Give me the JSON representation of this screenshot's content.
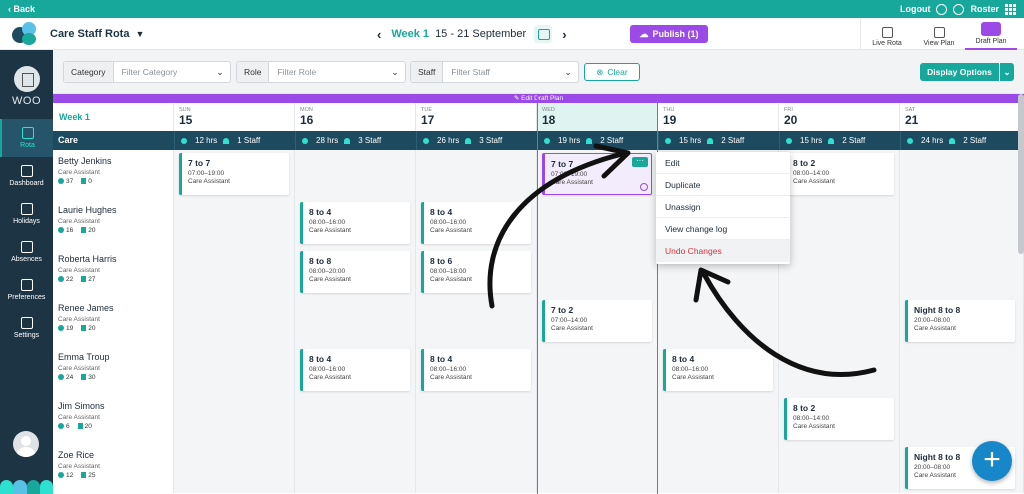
{
  "topbar": {
    "back": "‹ Back",
    "logout": "Logout",
    "roster": "Roster"
  },
  "header": {
    "app_title": "Care Staff Rota",
    "week_label": "Week 1",
    "week_range": "15 - 21 September",
    "publish_label": "Publish (1)"
  },
  "view_tabs": [
    {
      "label": "Live Rota"
    },
    {
      "label": "View Plan"
    },
    {
      "label": "Draft Plan",
      "active": true
    }
  ],
  "sidebar": {
    "org": "WOO",
    "items": [
      {
        "label": "Rota",
        "icon": "calendar-icon",
        "active": true
      },
      {
        "label": "Dashboard",
        "icon": "dashboard-icon"
      },
      {
        "label": "Holidays",
        "icon": "holiday-icon"
      },
      {
        "label": "Absences",
        "icon": "absence-icon"
      },
      {
        "label": "Preferences",
        "icon": "preferences-icon"
      },
      {
        "label": "Settings",
        "icon": "gear-icon"
      }
    ]
  },
  "filters": {
    "category": {
      "label": "Category",
      "placeholder": "Filter Category"
    },
    "role": {
      "label": "Role",
      "placeholder": "Filter Role"
    },
    "staff": {
      "label": "Staff",
      "placeholder": "Filter Staff"
    },
    "clear_label": "Clear",
    "display_options": "Display Options"
  },
  "draft_banner": "✎ Edit Draft Plan",
  "days": [
    {
      "name": "SUN",
      "date": "15",
      "hrs": "12 hrs",
      "staff": "1 Staff"
    },
    {
      "name": "MON",
      "date": "16",
      "hrs": "28 hrs",
      "staff": "3 Staff"
    },
    {
      "name": "TUE",
      "date": "17",
      "hrs": "26 hrs",
      "staff": "3 Staff"
    },
    {
      "name": "WED",
      "date": "18",
      "hrs": "19 hrs",
      "staff": "2 Staff"
    },
    {
      "name": "THU",
      "date": "19",
      "hrs": "15 hrs",
      "staff": "2 Staff"
    },
    {
      "name": "FRI",
      "date": "20",
      "hrs": "15 hrs",
      "staff": "2 Staff"
    },
    {
      "name": "SAT",
      "date": "21",
      "hrs": "24 hrs",
      "staff": "2 Staff"
    }
  ],
  "category": "Care",
  "staff": [
    {
      "name": "Betty Jenkins",
      "role": "Care Assistant",
      "hours": "37",
      "shifts": "0",
      "shifts_by_day": [
        {
          "day": 0,
          "title": "7 to 7",
          "time": "07:00–19:00",
          "role": "Care Assistant"
        },
        {
          "day": 3,
          "title": "7 to 7",
          "time": "07:00–19:00",
          "role": "Care Assistant",
          "selected": true
        },
        {
          "day": 5,
          "title": "8 to 2",
          "time": "08:00–14:00",
          "role": "Care Assistant"
        }
      ]
    },
    {
      "name": "Laurie Hughes",
      "role": "Care Assistant",
      "hours": "16",
      "shifts": "20",
      "shifts_by_day": [
        {
          "day": 1,
          "title": "8 to 4",
          "time": "08:00–16:00",
          "role": "Care Assistant"
        },
        {
          "day": 2,
          "title": "8 to 4",
          "time": "08:00–16:00",
          "role": "Care Assistant"
        }
      ]
    },
    {
      "name": "Roberta Harris",
      "role": "Care Assistant",
      "hours": "22",
      "shifts": "27",
      "shifts_by_day": [
        {
          "day": 1,
          "title": "8 to 8",
          "time": "08:00–20:00",
          "role": "Care Assistant"
        },
        {
          "day": 2,
          "title": "8 to 6",
          "time": "08:00–18:00",
          "role": "Care Assistant"
        }
      ]
    },
    {
      "name": "Renee James",
      "role": "Care Assistant",
      "hours": "19",
      "shifts": "20",
      "shifts_by_day": [
        {
          "day": 3,
          "title": "7 to 2",
          "time": "07:00–14:00",
          "role": "Care Assistant"
        },
        {
          "day": 6,
          "title": "Night 8 to 8",
          "time": "20:00–08:00",
          "role": "Care Assistant"
        }
      ]
    },
    {
      "name": "Emma Troup",
      "role": "Care Assistant",
      "hours": "24",
      "shifts": "30",
      "shifts_by_day": [
        {
          "day": 1,
          "title": "8 to 4",
          "time": "08:00–16:00",
          "role": "Care Assistant"
        },
        {
          "day": 2,
          "title": "8 to 4",
          "time": "08:00–16:00",
          "role": "Care Assistant"
        },
        {
          "day": 4,
          "title": "8 to 4",
          "time": "08:00–16:00",
          "role": "Care Assistant"
        }
      ]
    },
    {
      "name": "Jim Simons",
      "role": "Care Assistant",
      "hours": "6",
      "shifts": "20",
      "shifts_by_day": [
        {
          "day": 5,
          "title": "8 to 2",
          "time": "08:00–14:00",
          "role": "Care Assistant"
        }
      ]
    },
    {
      "name": "Zoe Rice",
      "role": "Care Assistant",
      "hours": "12",
      "shifts": "25",
      "shifts_by_day": [
        {
          "day": 6,
          "title": "Night 8 to 8",
          "time": "20:00–08:00",
          "role": "Care Assistant"
        }
      ]
    }
  ],
  "context_menu": [
    "Edit",
    "Duplicate",
    "Unassign",
    "View change log",
    "Undo Changes"
  ],
  "colors": {
    "accent": "#17a89b",
    "draft": "#9b4ae8",
    "navy": "#1d3445",
    "danger": "#d6343b",
    "fab": "#1787c9"
  }
}
